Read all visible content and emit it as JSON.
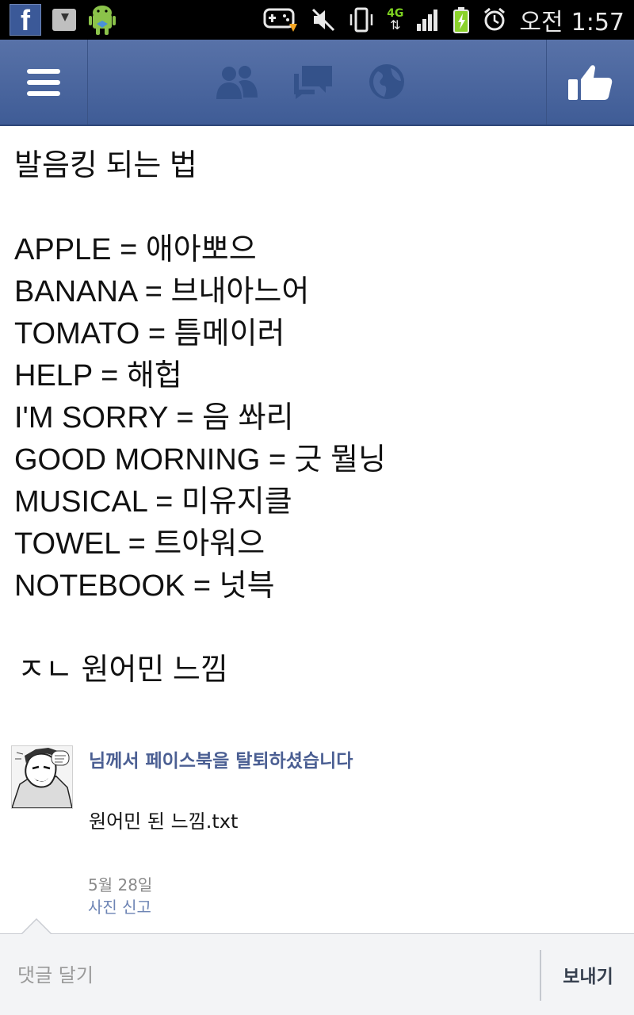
{
  "status_bar": {
    "notification_icons": [
      "facebook-icon",
      "download-icon",
      "android-icon"
    ],
    "system_icons": [
      "game-controller-icon",
      "mute-icon",
      "vibrate-icon",
      "4g-data-icon",
      "signal-icon",
      "battery-charging-icon",
      "alarm-icon"
    ],
    "network_label": "4G",
    "ampm": "오전",
    "time": "1:57"
  },
  "app_bar": {
    "icons": [
      "menu-icon",
      "friends-icon",
      "messages-icon",
      "notifications-globe-icon",
      "like-icon"
    ],
    "colors": {
      "bar": "#4b679f",
      "icon": "#ffffff",
      "tab_icon": "#34528a"
    }
  },
  "photo": {
    "title": "발음킹 되는 법",
    "lines": [
      "APPLE = 애아뽀으",
      "BANANA = 브내아느어",
      "TOMATO = 틈메이러",
      "HELP = 해헙",
      "I'M SORRY = 음 쏴리",
      "GOOD MORNING = 긋 뭘닝",
      "MUSICAL = 미유지클",
      "TOWEL = 트아워으",
      "NOTEBOOK = 넛븍"
    ],
    "footer": "ㅈㄴ 원어민 느낌"
  },
  "comment": {
    "author": "님께서 페이스북을 탈퇴하셨습니다",
    "text": "원어민 된 느낌.txt",
    "date": "5월 28일",
    "report_link": "사진 신고",
    "colors": {
      "author": "#4b5f93",
      "link": "#6d84b4"
    }
  },
  "input_bar": {
    "placeholder": "댓글 달기",
    "value": "",
    "send_label": "보내기"
  }
}
